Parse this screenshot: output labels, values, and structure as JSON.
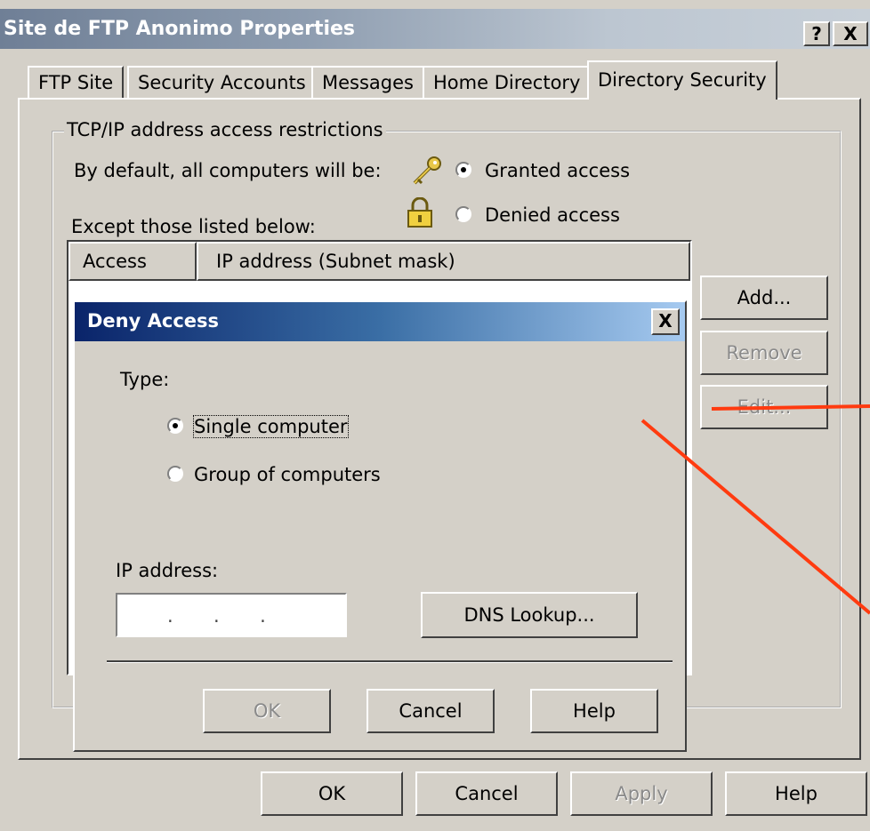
{
  "window": {
    "title": "Site de FTP Anonimo Properties",
    "help_btn": "?",
    "close_btn": "X"
  },
  "tabs": [
    "FTP Site",
    "Security Accounts",
    "Messages",
    "Home Directory",
    "Directory Security"
  ],
  "active_tab": "Directory Security",
  "restrictions": {
    "group_label": "TCP/IP address access restrictions",
    "default_label": "By default, all computers will be:",
    "granted_label": "Granted access",
    "denied_label": "Denied access",
    "selected": "granted",
    "except_label": "Except  those listed below:",
    "columns": [
      "Access",
      "IP address (Subnet mask)"
    ],
    "add_button": "Add...",
    "remove_button": "Remove",
    "edit_button": "Edit..."
  },
  "dialog": {
    "title": "Deny Access",
    "close_btn": "X",
    "type_label": "Type:",
    "single_label": "Single computer",
    "group_label": "Group of computers",
    "selected": "single",
    "ip_label": "IP address:",
    "ip_value": ".     .     .",
    "dns_button": "DNS Lookup...",
    "ok_button": "OK",
    "cancel_button": "Cancel",
    "help_button": "Help"
  },
  "footer": {
    "ok_button": "OK",
    "cancel_button": "Cancel",
    "apply_button": "Apply",
    "help_button": "Help"
  },
  "colors": {
    "annotation_line": "#ff3b10",
    "dialog_title_start": "#0a246a",
    "dialog_title_end": "#a6caf0"
  }
}
